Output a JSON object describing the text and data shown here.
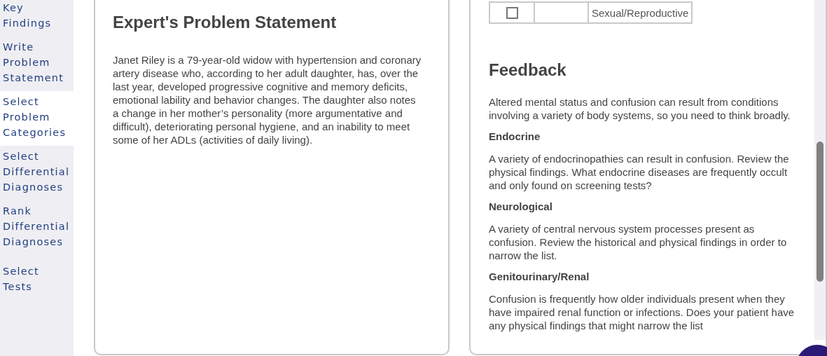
{
  "sidebar": {
    "items": [
      {
        "label": "Key Findings",
        "selected": false
      },
      {
        "label": "Write Problem Statement",
        "selected": false
      },
      {
        "label": "Select Problem Categories",
        "selected": true
      },
      {
        "label": "Select Differential Diagnoses",
        "selected": false
      },
      {
        "label": "Rank Differential Diagnoses",
        "selected": false
      },
      {
        "label": "Select Tests",
        "selected": false
      }
    ]
  },
  "expert_card": {
    "title": "Expert's Problem Statement",
    "text": "Janet Riley is a 79-year-old widow with hypertension and coronary artery disease who, according to her adult daughter, has, over the last year, developed progressive cognitive and memory deficits, emotional lability and behavior changes. The daughter also notes a change in her mother’s personality (more argumentative and difficult), deteriorating personal hygiene, and an inability to meet some of her ADLs (activities of daily living)."
  },
  "feedback_card": {
    "table": {
      "rows": [
        {
          "checked": false,
          "category": "Sexual/Reproductive"
        }
      ]
    },
    "title": "Feedback",
    "blocks": [
      {
        "kind": "paragraph",
        "text": "Altered mental status and confusion can result from conditions involving a variety of body systems, so you need to think broadly."
      },
      {
        "kind": "heading",
        "text": "Endocrine"
      },
      {
        "kind": "paragraph",
        "text": "A variety of endocrinopathies can result in confusion. Review the physical findings. What endocrine diseases are frequently occult and only found on screening tests?"
      },
      {
        "kind": "heading",
        "text": "Neurological"
      },
      {
        "kind": "paragraph",
        "text": "A variety of central nervous system processes present as confusion. Review the historical and physical findings in order to narrow the list."
      },
      {
        "kind": "heading",
        "text": "Genitourinary/Renal"
      },
      {
        "kind": "paragraph",
        "text": "Confusion is frequently how older individuals present when they have impaired renal function or infections. Does your patient have any physical findings that might narrow the list"
      }
    ]
  }
}
